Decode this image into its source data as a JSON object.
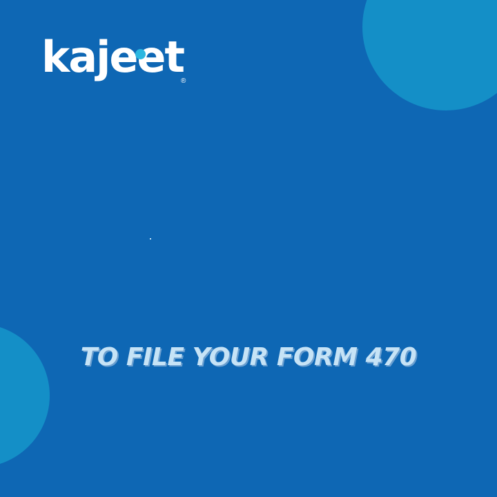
{
  "brand": {
    "name": "kajeet",
    "registered_mark": "®",
    "dot_color": "#2bb7e0"
  },
  "headline": {
    "text": "TO FILE YOUR FORM 470"
  },
  "colors": {
    "background": "#0e67b4",
    "circle_accent": "#148fc7",
    "headline_text": "#c6e3f6",
    "headline_shadow": "#6a9fd0"
  },
  "decorations": [
    {
      "name": "top-right-circle",
      "color": "#148fc7"
    },
    {
      "name": "bottom-left-circle",
      "color": "#148fc7"
    }
  ]
}
